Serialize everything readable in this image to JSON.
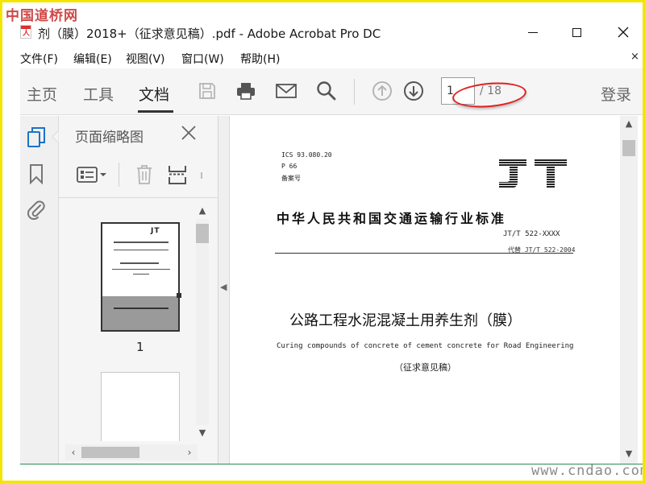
{
  "watermark_top": "中国道桥网",
  "watermark_bottom": "www.cndao.com",
  "window": {
    "title": "剂（膜）2018+（征求意见稿）.pdf - Adobe Acrobat Pro DC",
    "file_icon_text": "人"
  },
  "menu": {
    "items": [
      "文件(F)",
      "编辑(E)",
      "视图(V)",
      "窗口(W)",
      "帮助(H)"
    ],
    "close_glyph": "×"
  },
  "toolbar": {
    "tabs": [
      {
        "label": "主页",
        "active": false
      },
      {
        "label": "工具",
        "active": false
      },
      {
        "label": "文档",
        "active": true
      }
    ],
    "page_current": "1",
    "page_total": "/ 18",
    "login_label": "登录"
  },
  "thumbnail_panel": {
    "title": "页面缩略图",
    "thumb1_number": "1",
    "thumb1_logo": "JT"
  },
  "document": {
    "meta_lines": [
      "ICS 93.080.20",
      "P 66",
      "备案号"
    ],
    "logo_text": "JT",
    "standard_title": "中华人民共和国交通运输行业标准",
    "standard_code": "JT/T 522-XXXX",
    "replaces": "代替 JT/T 522-2004",
    "title_cn": "公路工程水泥混凝土用养生剂（膜）",
    "title_en": "Curing compounds of concrete of cement concrete for Road Engineering",
    "draft_label": "（征求意见稿）"
  },
  "colors": {
    "frame_border": "#f2e600",
    "highlight_ellipse": "#e02020",
    "rail_active_icon": "#1a73c8",
    "bottom_line": "#2e8a4e",
    "watermark_top": "#d04848"
  }
}
